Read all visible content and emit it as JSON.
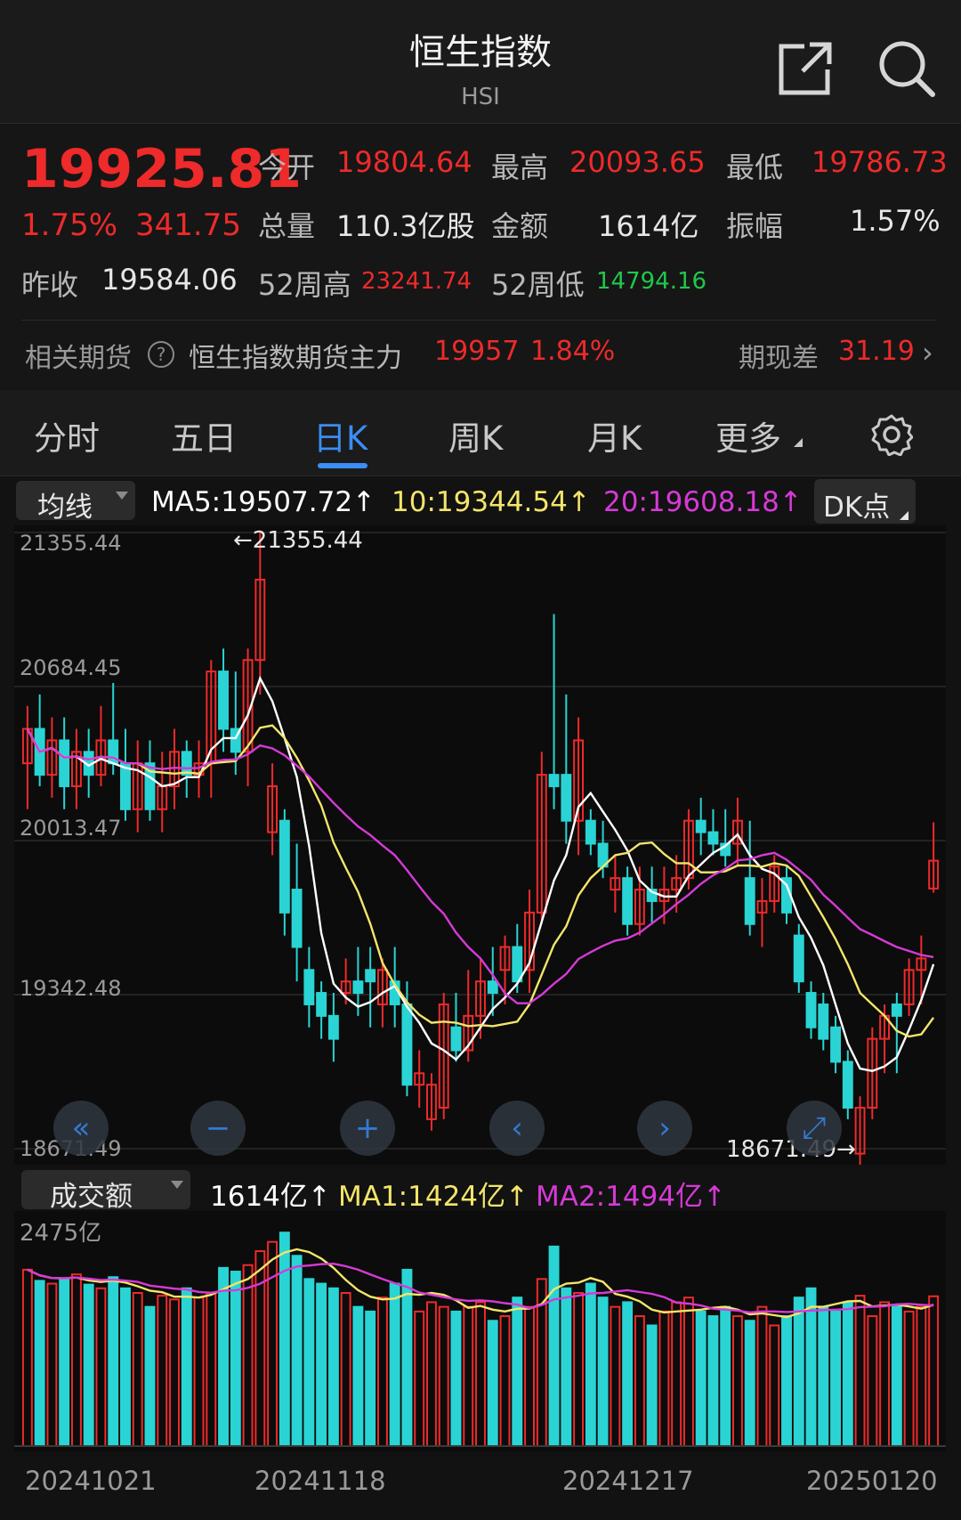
{
  "header": {
    "title": "恒生指数",
    "subtitle": "HSI",
    "share_icon": "share-icon",
    "search_icon": "search-icon"
  },
  "quote": {
    "price": "19925.81",
    "change_pct": "1.75%",
    "change": "341.75",
    "open_label": "今开",
    "open": "19804.64",
    "high_label": "最高",
    "high": "20093.65",
    "low_label": "最低",
    "low": "19786.73",
    "volume_label": "总量",
    "volume": "110.3亿股",
    "amount_label": "金额",
    "amount": "1614亿",
    "amplitude_label": "振幅",
    "amplitude": "1.57%",
    "prev_close_label": "昨收",
    "prev_close": "19584.06",
    "high52_label": "52周高",
    "high52": "23241.74",
    "low52_label": "52周低",
    "low52": "14794.16",
    "futures_label": "相关期货",
    "futures_name": "恒生指数期货主力",
    "futures_price": "19957",
    "futures_pct": "1.84%",
    "basis_label": "期现差",
    "basis": "31.19"
  },
  "tabs": [
    {
      "label": "分时"
    },
    {
      "label": "五日"
    },
    {
      "label": "日K",
      "active": true
    },
    {
      "label": "周K"
    },
    {
      "label": "月K"
    },
    {
      "label": "更多"
    }
  ],
  "ma_row": {
    "selector": "均线",
    "ma5": "MA5:19507.72↑",
    "ma10": "10:19344.54↑",
    "ma20": "20:19608.18↑",
    "dk": "DK点"
  },
  "price_axis": [
    "21355.44",
    "20684.45",
    "20013.47",
    "19342.48",
    "18671.49"
  ],
  "annotations": {
    "max": "←21355.44",
    "min": "18671.49→"
  },
  "vol_row": {
    "selector": "成交额",
    "amount": "1614亿↑",
    "ma1": "MA1:1424亿↑",
    "ma2": "MA2:1494亿↑",
    "axis_top": "2475亿"
  },
  "dates": [
    "20241021",
    "20241118",
    "20241217",
    "20250120"
  ],
  "colors": {
    "up": "#ee2a2a",
    "down": "#2ad4d4",
    "ma5": "#ffffff",
    "ma10": "#f3e56a",
    "ma20": "#d63ad6",
    "accent": "#3a8ef5"
  },
  "chart_data": {
    "type": "candlestick",
    "ylim": [
      18671.49,
      21355.44
    ],
    "ohlc": [
      [
        20350,
        20600,
        20150,
        20500
      ],
      [
        20500,
        20650,
        20250,
        20300
      ],
      [
        20300,
        20550,
        20200,
        20450
      ],
      [
        20450,
        20550,
        20150,
        20250
      ],
      [
        20250,
        20500,
        20150,
        20400
      ],
      [
        20400,
        20500,
        20200,
        20300
      ],
      [
        20300,
        20600,
        20250,
        20450
      ],
      [
        20450,
        20700,
        20300,
        20350
      ],
      [
        20350,
        20500,
        20100,
        20150
      ],
      [
        20150,
        20450,
        20050,
        20350
      ],
      [
        20350,
        20450,
        20100,
        20150
      ],
      [
        20150,
        20400,
        20050,
        20250
      ],
      [
        20250,
        20500,
        20150,
        20400
      ],
      [
        20400,
        20450,
        20200,
        20300
      ],
      [
        20300,
        20450,
        20200,
        20350
      ],
      [
        20350,
        20800,
        20200,
        20750
      ],
      [
        20750,
        20850,
        20400,
        20500
      ],
      [
        20500,
        20750,
        20300,
        20400
      ],
      [
        20400,
        20850,
        20250,
        20800
      ],
      [
        20800,
        21355,
        20650,
        21150
      ],
      [
        20050,
        20350,
        19950,
        20250
      ],
      [
        20100,
        20150,
        19600,
        19700
      ],
      [
        19800,
        20000,
        19400,
        19550
      ],
      [
        19450,
        19550,
        19200,
        19300
      ],
      [
        19350,
        19400,
        19150,
        19250
      ],
      [
        19250,
        19350,
        19050,
        19150
      ],
      [
        19350,
        19500,
        19300,
        19400
      ],
      [
        19400,
        19550,
        19250,
        19350
      ],
      [
        19450,
        19550,
        19200,
        19400
      ],
      [
        19300,
        19500,
        19200,
        19450
      ],
      [
        19400,
        19550,
        19200,
        19300
      ],
      [
        19300,
        19400,
        18900,
        18950
      ],
      [
        18950,
        19100,
        18850,
        19000
      ],
      [
        18800,
        19000,
        18750,
        18950
      ],
      [
        18850,
        19350,
        18800,
        19300
      ],
      [
        19200,
        19350,
        19050,
        19100
      ],
      [
        19100,
        19450,
        19050,
        19250
      ],
      [
        19250,
        19500,
        19150,
        19400
      ],
      [
        19400,
        19550,
        19250,
        19350
      ],
      [
        19450,
        19600,
        19300,
        19550
      ],
      [
        19550,
        19650,
        19350,
        19400
      ],
      [
        19450,
        19800,
        19350,
        19700
      ],
      [
        19700,
        20400,
        19650,
        20300
      ],
      [
        20300,
        21000,
        20150,
        20250
      ],
      [
        20300,
        20650,
        20000,
        20100
      ],
      [
        20100,
        20550,
        19950,
        20450
      ],
      [
        20100,
        20150,
        19950,
        20000
      ],
      [
        20000,
        20100,
        19850,
        19900
      ],
      [
        19800,
        19950,
        19700,
        19850
      ],
      [
        19850,
        19900,
        19600,
        19650
      ],
      [
        19650,
        19900,
        19600,
        19800
      ],
      [
        19800,
        19900,
        19650,
        19750
      ],
      [
        19750,
        19900,
        19650,
        19800
      ],
      [
        19800,
        19950,
        19700,
        19850
      ],
      [
        19850,
        20150,
        19800,
        20100
      ],
      [
        20100,
        20200,
        19950,
        20050
      ],
      [
        20050,
        20150,
        19950,
        20000
      ],
      [
        20000,
        20150,
        19900,
        19950
      ],
      [
        20000,
        20200,
        19900,
        20100
      ],
      [
        19850,
        20100,
        19600,
        19650
      ],
      [
        19700,
        19850,
        19550,
        19750
      ],
      [
        19750,
        19950,
        19700,
        19900
      ],
      [
        19850,
        19900,
        19650,
        19700
      ],
      [
        19600,
        19650,
        19350,
        19400
      ],
      [
        19350,
        19400,
        19150,
        19200
      ],
      [
        19300,
        19350,
        19100,
        19150
      ],
      [
        19200,
        19250,
        19000,
        19050
      ],
      [
        19050,
        19100,
        18800,
        18850
      ],
      [
        18650,
        18900,
        18600,
        18850
      ],
      [
        18850,
        19200,
        18800,
        19150
      ],
      [
        19150,
        19300,
        19000,
        19250
      ],
      [
        19300,
        19350,
        19000,
        19250
      ],
      [
        19300,
        19500,
        19250,
        19450
      ],
      [
        19450,
        19600,
        19300,
        19500
      ],
      [
        19804.64,
        20093.65,
        19786.73,
        19925.81
      ]
    ],
    "volume": [
      1900,
      1780,
      1750,
      1800,
      1850,
      1740,
      1700,
      1820,
      1700,
      1650,
      1500,
      1620,
      1580,
      1700,
      1600,
      1650,
      1920,
      1880,
      1950,
      2100,
      2200,
      2300,
      2050,
      1800,
      1750,
      1700,
      1650,
      1500,
      1450,
      1600,
      1750,
      1900,
      1450,
      1550,
      1500,
      1450,
      1500,
      1550,
      1350,
      1400,
      1600,
      1500,
      1800,
      2150,
      1700,
      1650,
      1750,
      1600,
      1500,
      1550,
      1400,
      1300,
      1450,
      1550,
      1600,
      1450,
      1400,
      1500,
      1400,
      1350,
      1500,
      1300,
      1400,
      1600,
      1700,
      1500,
      1450,
      1550,
      1620,
      1400,
      1550,
      1500,
      1450,
      1500,
      1614
    ],
    "ma5_volume_label": "MA1",
    "ma10_volume_label": "MA2"
  }
}
